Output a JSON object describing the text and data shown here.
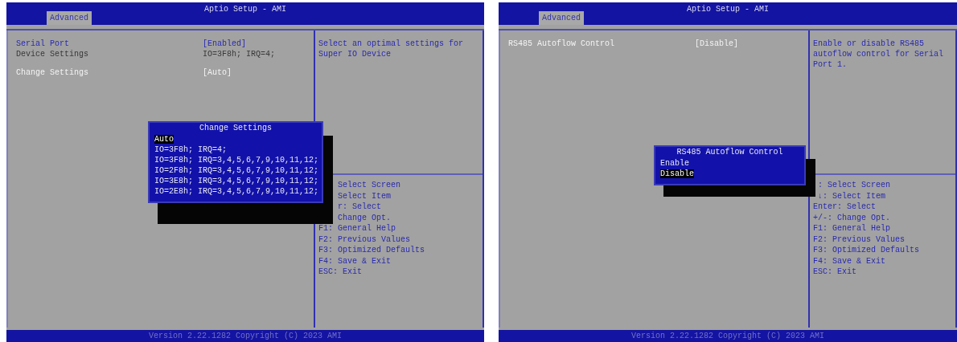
{
  "screens": [
    {
      "title": "Aptio Setup - AMI",
      "tabs": [
        {
          "label": "Advanced",
          "selected": true
        }
      ],
      "items": [
        {
          "kind": "setting",
          "label": "Serial Port",
          "value": "[Enabled]",
          "selected": false
        },
        {
          "kind": "info",
          "label": "Device Settings",
          "value": "IO=3F8h; IRQ=4;",
          "selected": false
        },
        {
          "kind": "gap"
        },
        {
          "kind": "setting",
          "label": "Change Settings",
          "value": "[Auto]",
          "selected": true
        }
      ],
      "help_text": "Select an optimal settings for Super IO Device",
      "key_help": [
        {
          "text": "Select Screen",
          "covered": true
        },
        {
          "text": "Select Item",
          "covered": true
        },
        {
          "text": "r: Select",
          "covered": true
        },
        {
          "text": "Change Opt.",
          "covered": true
        },
        {
          "text": "F1: General Help",
          "covered": false
        },
        {
          "text": "F2: Previous Values",
          "covered": false
        },
        {
          "text": "F3: Optimized Defaults",
          "covered": false
        },
        {
          "text": "F4: Save & Exit",
          "covered": false
        },
        {
          "text": "ESC: Exit",
          "covered": false
        }
      ],
      "popup": {
        "title": "Change Settings",
        "options": [
          {
            "label": "Auto",
            "selected": true
          },
          {
            "label": "IO=3F8h; IRQ=4;",
            "selected": false
          },
          {
            "label": "IO=3F8h; IRQ=3,4,5,6,7,9,10,11,12;",
            "selected": false
          },
          {
            "label": "IO=2F8h; IRQ=3,4,5,6,7,9,10,11,12;",
            "selected": false
          },
          {
            "label": "IO=3E8h; IRQ=3,4,5,6,7,9,10,11,12;",
            "selected": false
          },
          {
            "label": "IO=2E8h; IRQ=3,4,5,6,7,9,10,11,12;",
            "selected": false
          }
        ]
      },
      "footer": "Version 2.22.1282 Copyright (C) 2023 AMI"
    },
    {
      "title": "Aptio Setup - AMI",
      "tabs": [
        {
          "label": "Advanced",
          "selected": true
        }
      ],
      "items": [
        {
          "kind": "setting",
          "label": "RS485 Autoflow Control",
          "value": "[Disable]",
          "selected": true
        }
      ],
      "help_text": "Enable or disable RS485 autoflow control for Serial Port 1.",
      "key_help": [
        {
          "text": ": Select Screen",
          "covered": true
        },
        {
          "text": "↓: Select Item",
          "covered": true
        },
        {
          "text": "Enter: Select",
          "covered": false
        },
        {
          "text": "+/-: Change Opt.",
          "covered": false
        },
        {
          "text": "F1: General Help",
          "covered": false
        },
        {
          "text": "F2: Previous Values",
          "covered": false
        },
        {
          "text": "F3: Optimized Defaults",
          "covered": false
        },
        {
          "text": "F4: Save & Exit",
          "covered": false
        },
        {
          "text": "ESC: Exit",
          "covered": false
        }
      ],
      "popup": {
        "title": "RS485 Autoflow Control",
        "options": [
          {
            "label": "Enable",
            "selected": false
          },
          {
            "label": "Disable",
            "selected": true
          }
        ]
      },
      "footer": "Version 2.22.1282 Copyright (C) 2023 AMI"
    }
  ]
}
